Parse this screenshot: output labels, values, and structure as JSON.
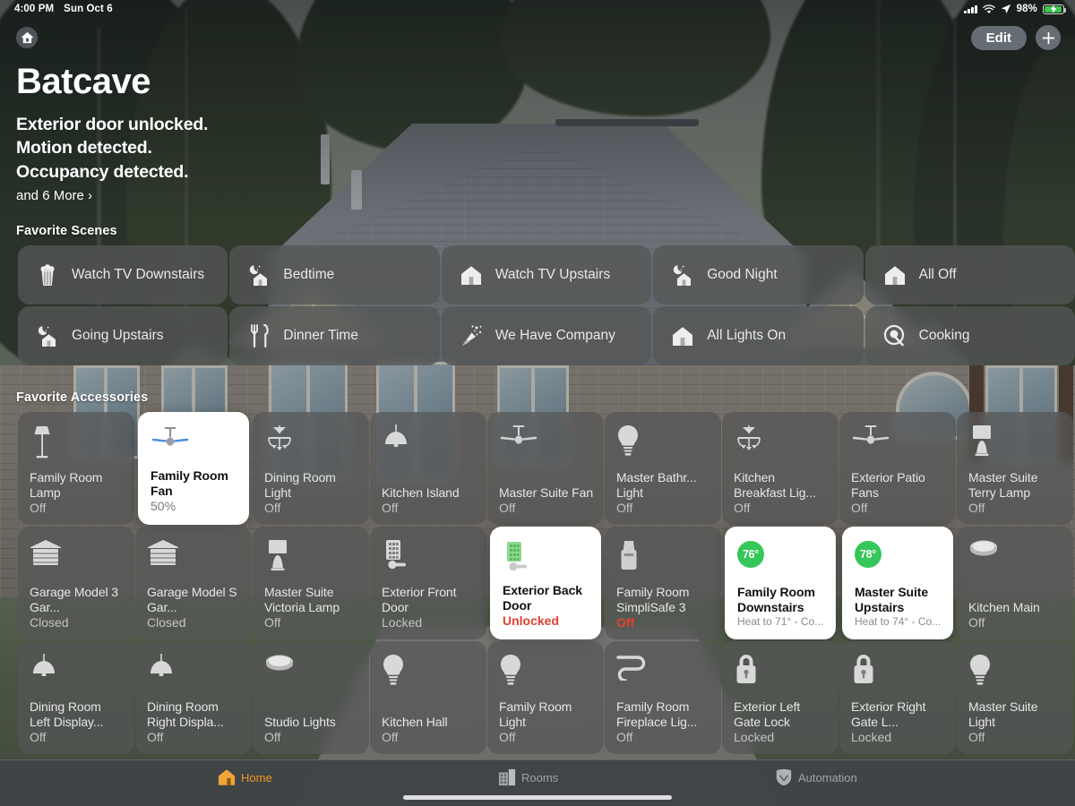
{
  "status_bar": {
    "time": "4:00 PM",
    "date": "Sun Oct 6",
    "battery_percent": "98%",
    "icons": [
      "cellular-signal-icon",
      "wifi-icon",
      "location-arrow-icon",
      "battery-charging-icon"
    ]
  },
  "header": {
    "home_icon": "home-icon",
    "edit_label": "Edit",
    "add_label": "+",
    "title": "Batcave",
    "status_lines": [
      "Exterior door unlocked.",
      "Motion detected.",
      "Occupancy detected."
    ],
    "more_label": "and 6 More ›"
  },
  "sections": {
    "scenes_title": "Favorite Scenes",
    "accessories_title": "Favorite Accessories"
  },
  "scenes": [
    {
      "label": "Watch TV Downstairs",
      "icon": "popcorn-icon"
    },
    {
      "label": "Bedtime",
      "icon": "moon-house-icon"
    },
    {
      "label": "Watch TV Upstairs",
      "icon": "house-icon"
    },
    {
      "label": "Good Night",
      "icon": "moon-house-icon"
    },
    {
      "label": "All Off",
      "icon": "house-icon"
    },
    {
      "label": "Going Upstairs",
      "icon": "moon-house-icon"
    },
    {
      "label": "Dinner Time",
      "icon": "fork-knife-icon"
    },
    {
      "label": "We Have Company",
      "icon": "party-popper-icon"
    },
    {
      "label": "All Lights On",
      "icon": "house-icon"
    },
    {
      "label": "Cooking",
      "icon": "pan-icon"
    }
  ],
  "accessories": [
    [
      {
        "name": "Family Room Lamp",
        "state": "Off",
        "icon": "floor-lamp-icon",
        "on": false
      },
      {
        "name": "Family Room Fan",
        "state": "50%",
        "icon": "ceiling-fan-icon",
        "on": true
      },
      {
        "name": "Dining Room Light",
        "state": "Off",
        "icon": "chandelier-icon",
        "on": false
      },
      {
        "name": "Kitchen Island",
        "state": "Off",
        "icon": "pendant-lamp-icon",
        "on": false
      },
      {
        "name": "Master Suite Fan",
        "state": "Off",
        "icon": "ceiling-fan-icon",
        "on": false
      },
      {
        "name": "Master Bathr... Light",
        "state": "Off",
        "icon": "bulb-icon",
        "on": false
      },
      {
        "name": "Kitchen Breakfast Lig...",
        "state": "Off",
        "icon": "chandelier-icon",
        "on": false
      },
      {
        "name": "Exterior Patio Fans",
        "state": "Off",
        "icon": "ceiling-fan-icon",
        "on": false
      },
      {
        "name": "Master Suite Terry Lamp",
        "state": "Off",
        "icon": "table-lamp-icon",
        "on": false
      }
    ],
    [
      {
        "name": "Garage Model 3 Gar...",
        "state": "Closed",
        "icon": "garage-door-icon",
        "on": false
      },
      {
        "name": "Garage Model S Gar...",
        "state": "Closed",
        "icon": "garage-door-icon",
        "on": false
      },
      {
        "name": "Master Suite Victoria Lamp",
        "state": "Off",
        "icon": "table-lamp-icon",
        "on": false
      },
      {
        "name": "Exterior Front Door",
        "state": "Locked",
        "icon": "keypad-lock-icon",
        "on": false
      },
      {
        "name": "Exterior Back Door",
        "state": "Unlocked",
        "icon": "keypad-lock-green-icon",
        "on": true,
        "alert": true
      },
      {
        "name": "Family Room SimpliSafe 3",
        "state": "Off",
        "icon": "security-base-icon",
        "on": false,
        "alert": true
      },
      {
        "name": "Family Room Downstairs",
        "state": "Heat to 71° - Co...",
        "icon": "thermostat-icon",
        "on": true,
        "temp": "76°"
      },
      {
        "name": "Master Suite Upstairs",
        "state": "Heat to 74° - Co...",
        "icon": "thermostat-icon",
        "on": true,
        "temp": "78°"
      },
      {
        "name": "Kitchen Main",
        "state": "Off",
        "icon": "puck-light-icon",
        "on": false
      }
    ],
    [
      {
        "name": "Dining Room Left Display...",
        "state": "Off",
        "icon": "pendant-lamp-icon",
        "on": false
      },
      {
        "name": "Dining Room Right Displa...",
        "state": "Off",
        "icon": "pendant-lamp-icon",
        "on": false
      },
      {
        "name": "Studio Lights",
        "state": "Off",
        "icon": "puck-light-icon",
        "on": false
      },
      {
        "name": "Kitchen Hall",
        "state": "Off",
        "icon": "bulb-icon",
        "on": false
      },
      {
        "name": "Family Room Light",
        "state": "Off",
        "icon": "bulb-icon",
        "on": false
      },
      {
        "name": "Family Room Fireplace Lig...",
        "state": "Off",
        "icon": "light-strip-icon",
        "on": false
      },
      {
        "name": "Exterior Left Gate Lock",
        "state": "Locked",
        "icon": "padlock-icon",
        "on": false
      },
      {
        "name": "Exterior Right Gate L...",
        "state": "Locked",
        "icon": "padlock-icon",
        "on": false
      },
      {
        "name": "Master Suite Light",
        "state": "Off",
        "icon": "bulb-icon",
        "on": false
      }
    ]
  ],
  "tabs": [
    {
      "label": "Home",
      "icon": "home-filled-icon",
      "active": true
    },
    {
      "label": "Rooms",
      "icon": "rooms-icon",
      "active": false
    },
    {
      "label": "Automation",
      "icon": "automation-icon",
      "active": false
    }
  ],
  "colors": {
    "accent": "#f0961e",
    "alert": "#e0412f",
    "temp_badge": "#35c759",
    "tile_off": "rgba(84,86,86,.72)",
    "tile_on": "#ffffff"
  }
}
